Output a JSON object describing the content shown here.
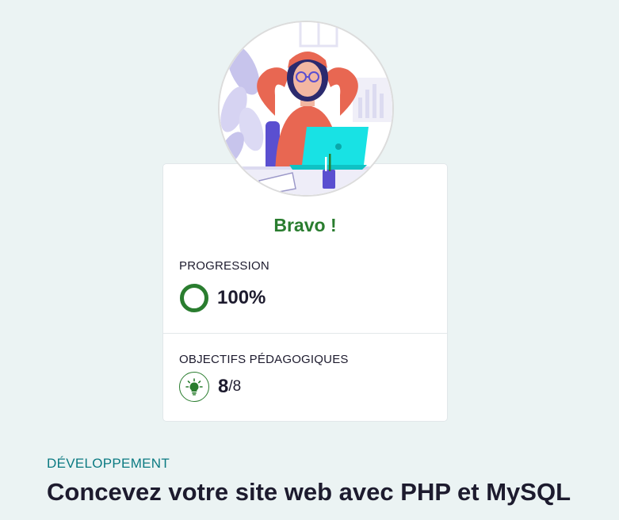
{
  "result": {
    "message": "Bravo !",
    "progress_label": "PROGRESSION",
    "progress_value": "100%",
    "progress_fraction": 1.0,
    "objectives_label": "OBJECTIFS PÉDAGOGIQUES",
    "objectives_done": "8",
    "objectives_total": "/8"
  },
  "course": {
    "category": "DÉVELOPPEMENT",
    "title": "Concevez votre site web avec PHP et MySQL"
  },
  "colors": {
    "background": "#ebf3f3",
    "success_green": "#2a7d2f",
    "category_teal": "#0b7a82",
    "text_dark": "#1d1b2e"
  },
  "icons": {
    "progress": "progress-ring-icon",
    "objectives": "lightbulb-icon"
  }
}
